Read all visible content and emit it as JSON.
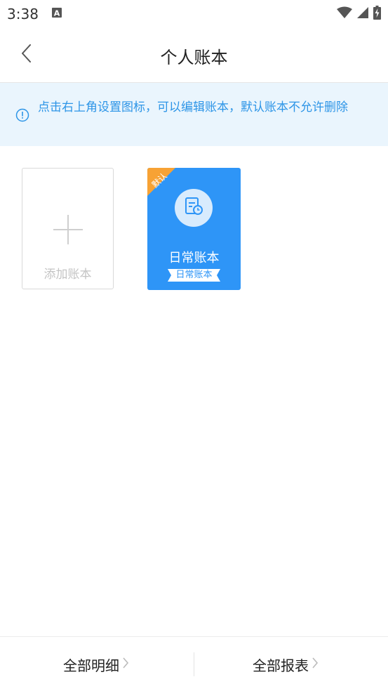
{
  "status_bar": {
    "time": "3:38",
    "notification_icon": "a-letter-icon",
    "icons": [
      "wifi-icon",
      "signal-icon",
      "battery-charging-icon"
    ]
  },
  "nav": {
    "title": "个人账本",
    "back_icon": "chevron-left-icon"
  },
  "notice": {
    "icon": "info-circle-icon",
    "text": "点击右上角设置图标，可以编辑账本，默认账本不允许删除",
    "color": "#2d95e7",
    "background": "#eaf5fd"
  },
  "books": {
    "add_label": "添加账本",
    "items": [
      {
        "name": "日常账本",
        "tag": "日常账本",
        "ribbon": "默认",
        "icon": "ledger-clock-icon",
        "color": "#2e95f7"
      }
    ]
  },
  "bottom": {
    "left_label": "全部明细",
    "right_label": "全部报表"
  }
}
